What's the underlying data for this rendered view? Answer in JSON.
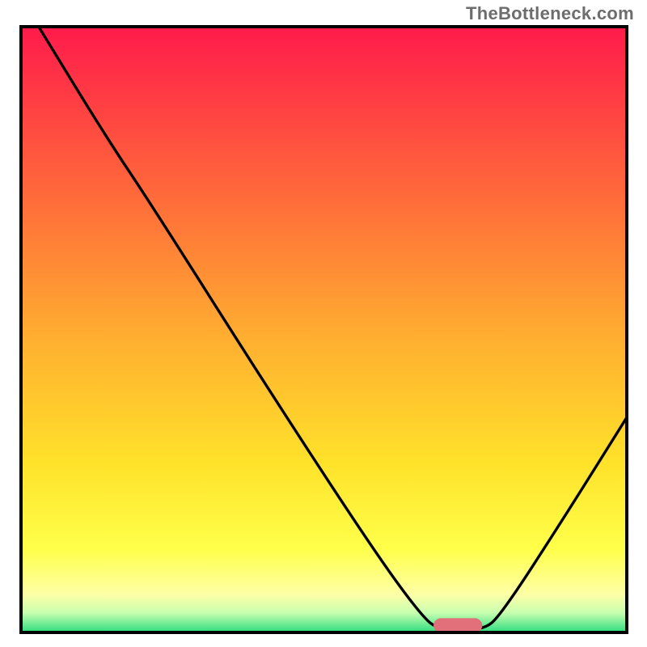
{
  "watermark": "TheBottleneck.com",
  "chart_data": {
    "type": "line",
    "title": "",
    "xlabel": "",
    "ylabel": "",
    "xlim": [
      0,
      100
    ],
    "ylim": [
      0,
      100
    ],
    "grid": false,
    "legend": false,
    "background_gradient_stops": [
      {
        "offset": 0.0,
        "color": "#ff1a4b"
      },
      {
        "offset": 0.28,
        "color": "#ff6a3a"
      },
      {
        "offset": 0.52,
        "color": "#ffb030"
      },
      {
        "offset": 0.72,
        "color": "#ffe22a"
      },
      {
        "offset": 0.86,
        "color": "#ffff4a"
      },
      {
        "offset": 0.935,
        "color": "#fdffa6"
      },
      {
        "offset": 0.965,
        "color": "#c8ffb0"
      },
      {
        "offset": 1.0,
        "color": "#1fd97a"
      }
    ],
    "curve_points": [
      {
        "x": 3.0,
        "y": 100.0
      },
      {
        "x": 14.0,
        "y": 82.0
      },
      {
        "x": 22.0,
        "y": 70.0
      },
      {
        "x": 41.0,
        "y": 40.0
      },
      {
        "x": 58.0,
        "y": 14.0
      },
      {
        "x": 66.0,
        "y": 3.0
      },
      {
        "x": 69.0,
        "y": 0.6
      },
      {
        "x": 76.0,
        "y": 0.6
      },
      {
        "x": 79.0,
        "y": 3.0
      },
      {
        "x": 90.0,
        "y": 20.0
      },
      {
        "x": 100.0,
        "y": 36.0
      }
    ],
    "marker": {
      "x_center": 72.0,
      "y_center": 1.4,
      "width": 8.0,
      "height": 2.4,
      "rx": 1.2,
      "color": "#e2707a"
    }
  }
}
